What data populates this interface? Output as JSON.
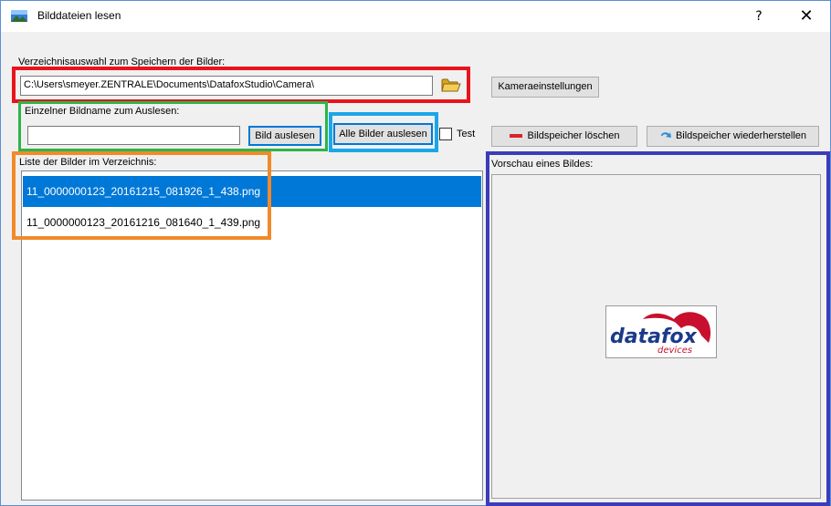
{
  "window": {
    "title": "Bilddateien lesen",
    "help_glyph": "?",
    "close_glyph": "✕"
  },
  "directory": {
    "label": "Verzeichnisauswahl zum Speichern der Bilder:",
    "path": "C:\\Users\\smeyer.ZENTRALE\\Documents\\DatafoxStudio\\Camera\\",
    "browse_icon": "folder-open-icon"
  },
  "camera_settings_button": "Kameraeinstellungen",
  "single_image": {
    "label": "Einzelner Bildname zum Auslesen:",
    "value": "",
    "read_button": "Bild auslesen"
  },
  "read_all_button": "Alle Bilder auslesen",
  "test_checkbox": {
    "label": "Test",
    "checked": false
  },
  "delete_memory_button": {
    "label": "Bildspeicher löschen",
    "icon": "minus-icon"
  },
  "restore_memory_button": {
    "label": "Bildspeicher wiederherstellen",
    "icon": "restore-arrow-icon"
  },
  "image_list": {
    "label": "Liste der Bilder im Verzeichnis:",
    "items": [
      "11_0000000123_20161215_081926_1_438.png",
      "11_0000000123_20161216_081640_1_439.png"
    ],
    "selected_index": 0
  },
  "preview": {
    "label": "Vorschau eines Bildes:",
    "logo_text": "datafox",
    "logo_subtext": "devices"
  },
  "colors": {
    "highlight_red": "#e8141c",
    "highlight_green": "#2eb34a",
    "highlight_cyan": "#1aa7e8",
    "highlight_orange": "#f08a2a",
    "highlight_purple": "#3c3cb8",
    "selection": "#0078d7"
  }
}
